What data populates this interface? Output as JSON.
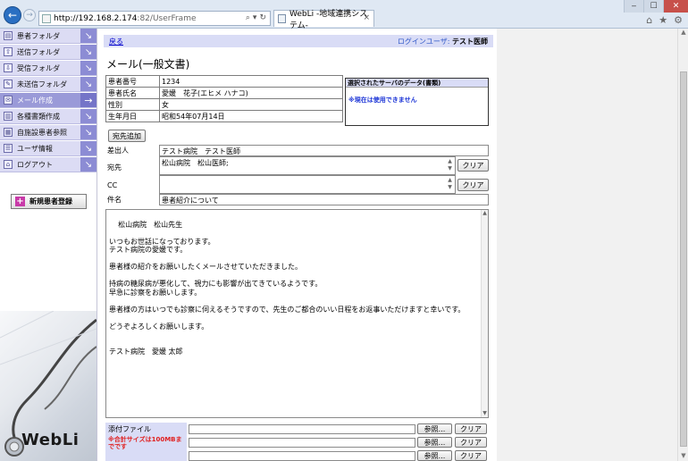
{
  "browser": {
    "url_host": "http://192.168.2.174",
    "url_path": ":82/UserFrame",
    "tab_title": "WebLi -地域連携システム-",
    "addr_tools": [
      "⌕",
      "▾",
      "↻"
    ],
    "tab_close": "×",
    "window_buttons": [
      "‒",
      "☐",
      "✕"
    ],
    "toolbar_icons": [
      "⌂",
      "★",
      "⚙"
    ]
  },
  "sidebar": {
    "items": [
      {
        "label": "患者フォルダ",
        "icon": "folder-icon",
        "glyph": "▤"
      },
      {
        "label": "送信フォルダ",
        "icon": "upload-icon",
        "glyph": "⇧"
      },
      {
        "label": "受信フォルダ",
        "icon": "download-icon",
        "glyph": "⇩"
      },
      {
        "label": "未送信フォルダ",
        "icon": "pencil-icon",
        "glyph": "✎"
      },
      {
        "label": "メール作成",
        "icon": "mail-icon",
        "glyph": "✉"
      },
      {
        "label": "各種書類作成",
        "icon": "document-icon",
        "glyph": "▥"
      },
      {
        "label": "自施設患者参照",
        "icon": "hospital-icon",
        "glyph": "▦"
      },
      {
        "label": "ユーザ情報",
        "icon": "user-icon",
        "glyph": "☰"
      },
      {
        "label": "ログアウト",
        "icon": "home-icon",
        "glyph": "⌂"
      }
    ],
    "arrow": "↘",
    "active_arrow": "→",
    "new_patient_plus": "+",
    "new_patient_label": "新規患者登録",
    "brand": "WebLi"
  },
  "header": {
    "back_link": "戻る",
    "login_label": "ログインユーザ:",
    "login_user": "テスト医師"
  },
  "page_title": "メール(一般文書)",
  "patient": [
    {
      "key": "患者番号",
      "value": "1234"
    },
    {
      "key": "患者氏名",
      "value": "愛媛　花子(エヒメ ハナコ)"
    },
    {
      "key": "性別",
      "value": "女"
    },
    {
      "key": "生年月日",
      "value": "昭和54年07月14日"
    }
  ],
  "server_box": {
    "header": "選択されたサーバのデータ(書類)",
    "message": "※現在は使用できません"
  },
  "form": {
    "add_recipient_button": "宛先追加",
    "sender_label": "差出人",
    "sender_value": "テスト病院　テスト医師",
    "to_label": "宛先",
    "to_value": "松山病院　松山医師;",
    "cc_label": "CC",
    "cc_value": "",
    "clear_label": "クリア",
    "subject_label": "件名",
    "subject_value": "患者紹介について",
    "body": "松山病院　松山先生\n\nいつもお世話になっております。\nテスト病院の愛媛です。\n\n患者様の紹介をお願いしたくメールさせていただきました。\n\n持病の糖尿病が悪化して、視力にも影響が出てきているようです。\n早急に診察をお願いします。\n\n患者様の方はいつでも診察に伺えるそうですので、先生のご都合のいい日程をお返事いただけますと幸いです。\n\nどうぞよろしくお願いします。\n\n\nテスト病院　愛媛 太郎"
  },
  "attachments": {
    "label": "添付ファイル",
    "note": "※合計サイズは100MBまでです",
    "browse_label": "参照...",
    "clear_label": "クリア",
    "rows": 3
  },
  "scroll": {
    "up": "▲",
    "down": "▼"
  }
}
